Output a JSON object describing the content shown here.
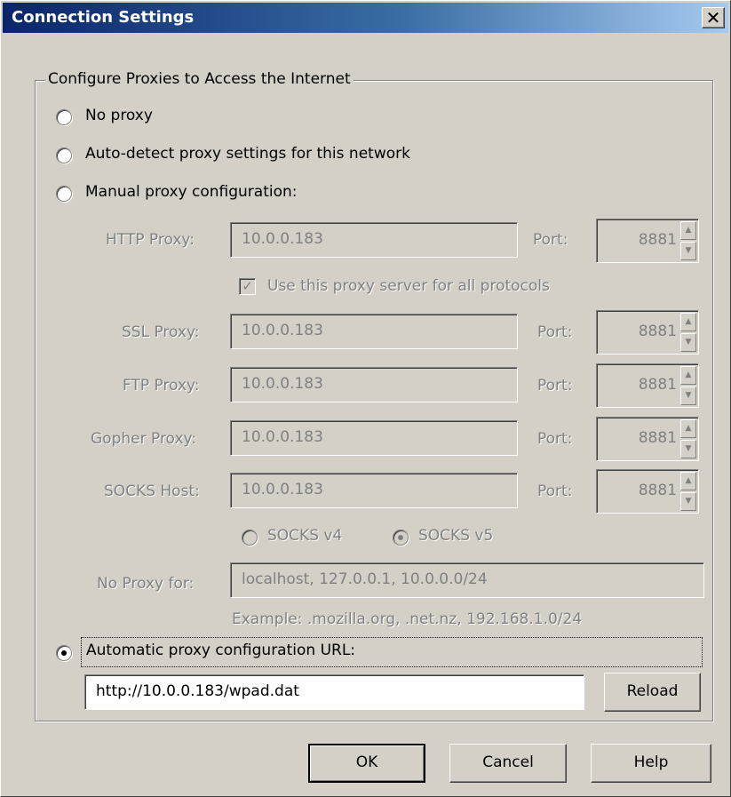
{
  "window": {
    "title": "Connection Settings",
    "close_glyph": "✕"
  },
  "group": {
    "legend": "Configure Proxies to Access the Internet"
  },
  "options": {
    "no_proxy": "No proxy",
    "auto_detect": "Auto-detect proxy settings for this network",
    "manual": "Manual proxy configuration:",
    "auto_url": "Automatic proxy configuration URL:"
  },
  "manual": {
    "http_label": "HTTP Proxy:",
    "http_value": "10.0.0.183",
    "http_port_label": "Port:",
    "http_port": "8881",
    "use_all_label": "Use this proxy server for all protocols",
    "ssl_label": "SSL Proxy:",
    "ssl_value": "10.0.0.183",
    "ssl_port_label": "Port:",
    "ssl_port": "8881",
    "ftp_label": "FTP Proxy:",
    "ftp_value": "10.0.0.183",
    "ftp_port_label": "Port:",
    "ftp_port": "8881",
    "gopher_label": "Gopher Proxy:",
    "gopher_value": "10.0.0.183",
    "gopher_port_label": "Port:",
    "gopher_port": "8881",
    "socks_label": "SOCKS Host:",
    "socks_value": "10.0.0.183",
    "socks_port_label": "Port:",
    "socks_port": "8881",
    "socks_v4": "SOCKS v4",
    "socks_v5": "SOCKS v5",
    "no_proxy_label": "No Proxy for:",
    "no_proxy_value": "localhost, 127.0.0.1, 10.0.0.0/24",
    "example": "Example: .mozilla.org, .net.nz, 192.168.1.0/24"
  },
  "auto": {
    "url_value": "http://10.0.0.183/wpad.dat",
    "reload": "Reload"
  },
  "buttons": {
    "ok": "OK",
    "cancel": "Cancel",
    "help": "Help"
  },
  "icons": {
    "checkmark": "✓",
    "spin_up": "▲",
    "spin_down": "▼"
  },
  "colors": {
    "face": "#d4d0c8",
    "title_start": "#0a246a",
    "title_end": "#a6caf0",
    "disabled_text": "#808080"
  }
}
